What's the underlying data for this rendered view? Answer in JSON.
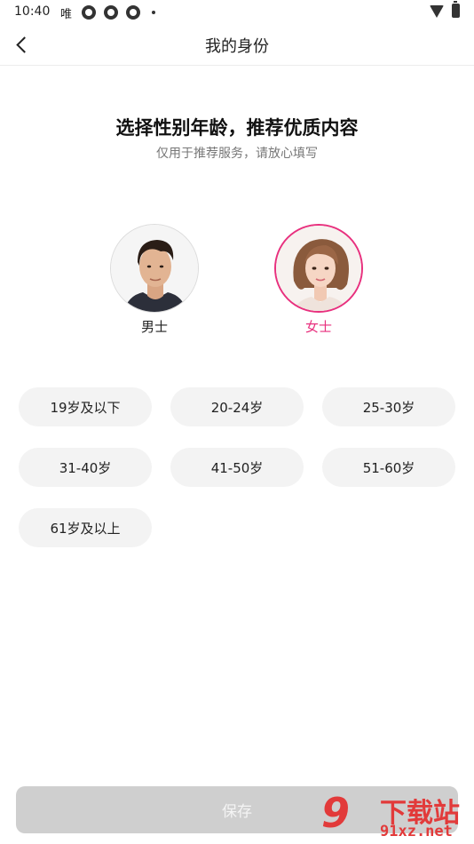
{
  "status_bar": {
    "time": "10:40",
    "carrier": "唯",
    "icons": [
      "app-notification-icon",
      "app-notification-icon",
      "app-notification-icon",
      "dot",
      "wifi-icon",
      "battery-icon"
    ]
  },
  "header": {
    "back_icon": "chevron-left-icon",
    "title": "我的身份"
  },
  "heading": {
    "title": "选择性别年龄，推荐优质内容",
    "subtitle": "仅用于推荐服务，请放心填写"
  },
  "gender": {
    "selected": "female",
    "male_label": "男士",
    "female_label": "女士",
    "accent_color": "#e8307e"
  },
  "ages": [
    "19岁及以下",
    "20-24岁",
    "25-30岁",
    "31-40岁",
    "41-50岁",
    "51-60岁",
    "61岁及以上"
  ],
  "save_label": "保存",
  "watermark": {
    "number": "9",
    "text": "下载站",
    "url": "91xz.net"
  }
}
